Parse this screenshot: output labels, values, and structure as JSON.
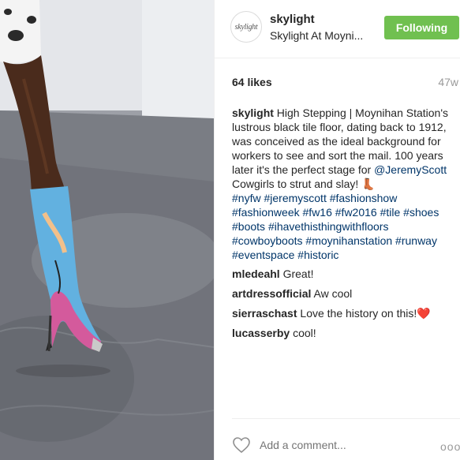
{
  "post": {
    "username": "skylight",
    "location": "Skylight At Moyni...",
    "avatar_text": "skylight",
    "follow_label": "Following",
    "likes": "64 likes",
    "time": "47w"
  },
  "caption": {
    "username": "skylight",
    "text_1": " High Stepping | Moynihan Station's lustrous black tile floor, dating back to 1912, was conceived as the ideal background for workers to see and sort the mail. 100 years later it's the perfect stage for ",
    "mention": "@JeremyScott",
    "text_2": " Cowgirls to strut and slay! ",
    "boot_emoji": "👢",
    "hashtags": [
      "#nyfw",
      "#jeremyscott",
      "#fashionshow",
      "#fashionweek",
      "#fw16",
      "#fw2016",
      "#tile",
      "#shoes",
      "#boots",
      "#ihavethisthingwithfloors",
      "#cowboyboots",
      "#moynihanstation",
      "#runway",
      "#eventspace",
      "#historic"
    ]
  },
  "comments": [
    {
      "user": "mledeahl",
      "text": "Great!"
    },
    {
      "user": "artdressofficial",
      "text": "Aw cool"
    },
    {
      "user": "sierraschast",
      "text": "Love the history on this!❤️"
    },
    {
      "user": "lucasserby",
      "text": "cool!"
    }
  ],
  "footer": {
    "comment_placeholder": "Add a comment...",
    "more_label": "ooo"
  },
  "colors": {
    "follow_bg": "#70c050",
    "hashtag": "#003569",
    "muted": "#999999"
  }
}
